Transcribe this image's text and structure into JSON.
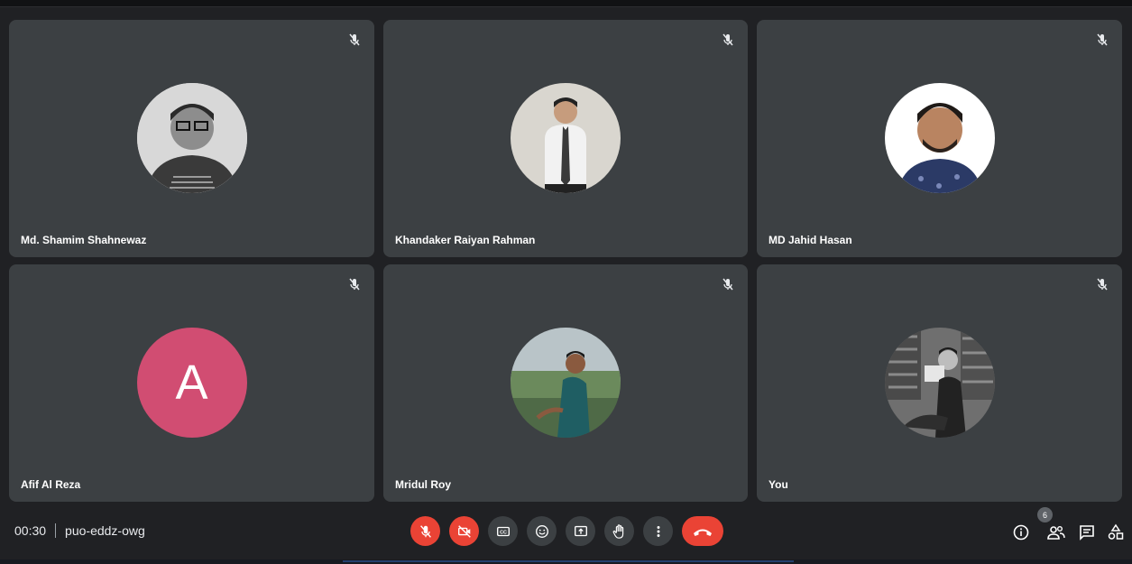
{
  "participants": [
    {
      "name": "Md. Shamim Shahnewaz",
      "type": "photo",
      "icon": "person-photo-icon"
    },
    {
      "name": "Khandaker Raiyan Rahman",
      "type": "photo",
      "icon": "person-photo-icon"
    },
    {
      "name": "MD Jahid Hasan",
      "type": "photo",
      "icon": "person-photo-icon"
    },
    {
      "name": "Afif Al Reza",
      "type": "letter",
      "letter": "A",
      "color": "#d14d72"
    },
    {
      "name": "Mridul Roy",
      "type": "photo",
      "icon": "person-photo-icon"
    },
    {
      "name": "You",
      "type": "photo",
      "icon": "person-photo-icon"
    }
  ],
  "meeting": {
    "time": "00:30",
    "code": "puo-eddz-owg"
  },
  "controls": [
    {
      "name": "mic-off-icon",
      "color": "#ea4335"
    },
    {
      "name": "camera-off-icon",
      "color": "#ea4335"
    },
    {
      "name": "captions-icon",
      "color": "#3c4043"
    },
    {
      "name": "emoji-icon",
      "color": "#3c4043"
    },
    {
      "name": "present-screen-icon",
      "color": "#3c4043"
    },
    {
      "name": "raise-hand-icon",
      "color": "#3c4043"
    },
    {
      "name": "more-options-icon",
      "color": "#3c4043"
    },
    {
      "name": "end-call-icon",
      "color": "#ea4335"
    }
  ],
  "side": {
    "people_count": "6",
    "icons": [
      "info-icon",
      "people-icon",
      "chat-icon",
      "activities-icon"
    ]
  },
  "colors": {
    "background": "#202124",
    "tile": "#3c4043",
    "danger": "#ea4335"
  }
}
